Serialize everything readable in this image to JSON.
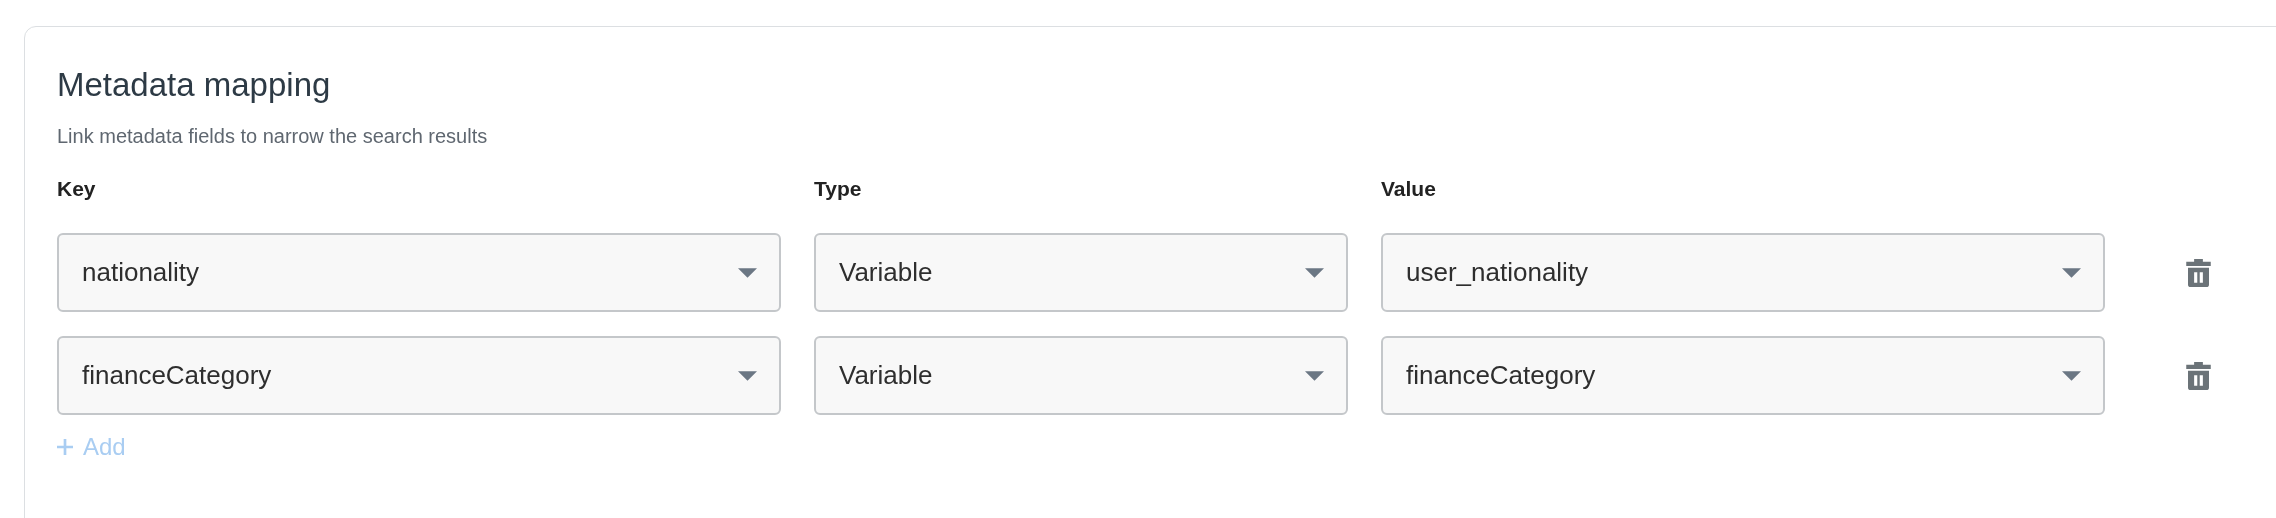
{
  "section": {
    "title": "Metadata mapping",
    "subtitle": "Link metadata fields to narrow the search results"
  },
  "columns": [
    "Key",
    "Type",
    "Value"
  ],
  "rows": [
    {
      "key": "nationality",
      "type": "Variable",
      "value": "user_nationality"
    },
    {
      "key": "financeCategory",
      "type": "Variable",
      "value": "financeCategory"
    }
  ],
  "add_button": {
    "label": "Add"
  }
}
